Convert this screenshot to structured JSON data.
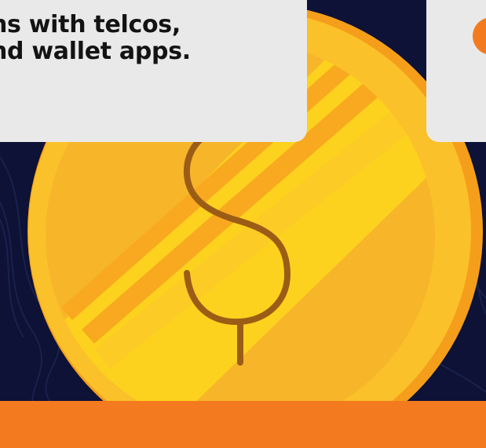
{
  "card": {
    "line1": "ns with telcos,",
    "line2": "nd wallet apps."
  },
  "colors": {
    "background": "#0d1236",
    "coin_rim": "#f5a524",
    "coin_face": "#fbc72a",
    "coin_stripe": "#fde25a",
    "dollar": "#9b5d16",
    "accent": "#f47a1f",
    "card": "#e9e9e9"
  },
  "icons": [
    "dollar-coin-icon"
  ]
}
